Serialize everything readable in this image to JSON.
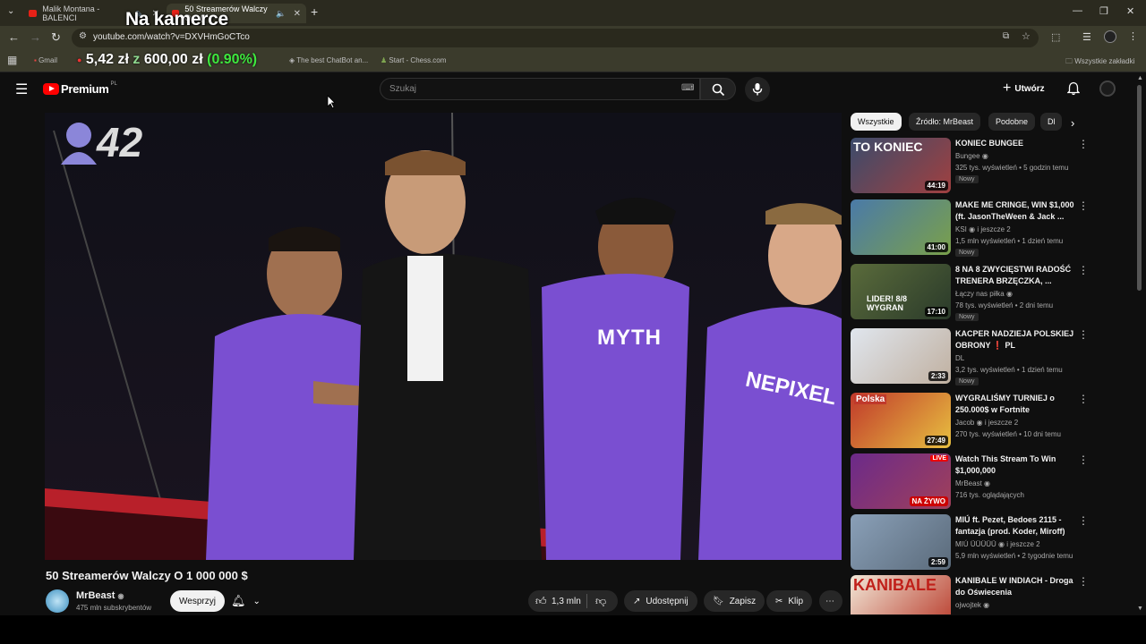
{
  "browser": {
    "tabs": [
      {
        "label": "Malik Montana - BALENCI",
        "active": false
      },
      {
        "label": "50 Streamerów Walczy O 1 (",
        "active": true
      }
    ],
    "new_tab": "+",
    "url": "youtube.com/watch?v=DXVHmGoCTco",
    "bookmarks": [
      {
        "label": "Gmail"
      },
      {
        "label": "The best ChatBot an..."
      },
      {
        "label": "Start - Chess.com"
      }
    ],
    "all_bookmarks": "Wszystkie zakładki"
  },
  "stream_overlay": {
    "title": "Na kamerce",
    "stock_prefix": "5,42 zł",
    "stock_z": "z",
    "stock_value": "600,00 zł",
    "stock_pct": "(0.90%)",
    "viewer_count": "42"
  },
  "youtube": {
    "logo": "Premium",
    "logo_sup": "PL",
    "search_placeholder": "Szukaj",
    "create_label": "Utwórz",
    "chips": [
      "Wszystkie",
      "Źródło: MrBeast",
      "Podobne",
      "Dl"
    ],
    "video": {
      "title": "50 Streamerów Walczy O 1 000 000 $",
      "shirt_text_1": "MYTH",
      "shirt_text_2": "NEPIXEL",
      "channel": "MrBeast",
      "subscribers": "475 mln subskrybentów",
      "support_label": "Wesprzyj",
      "likes": "1,3 mln",
      "share_label": "Udostępnij",
      "save_label": "Zapisz",
      "clip_label": "Klip"
    },
    "recommendations": [
      {
        "title": "KONIEC BUNGEE",
        "channel": "Bungee",
        "meta": "325 tys. wyświetleń • 5 godzin temu",
        "badge": "Nowy",
        "duration": "44:19",
        "thumb_text": "TO KONIEC",
        "color": "#3b4b6b"
      },
      {
        "title": "MAKE ME CRINGE, WIN $1,000 (ft. JasonTheWeen & Jack ...",
        "channel": "KSI",
        "channel_extra": "i jeszcze 2",
        "meta": "1,5 mln wyświetleń • 1 dzień temu",
        "badge": "Nowy",
        "duration": "41:00",
        "thumb_text": "",
        "color": "#4a7aa8"
      },
      {
        "title": "8 NA 8 ZWYCIĘSTWI RADOŚĆ TRENERA BRZĘCZKA, ...",
        "channel": "Łączy nas piłka",
        "meta": "78 tys. wyświetleń • 2 dni temu",
        "badge": "Nowy",
        "duration": "17:10",
        "thumb_text": "LIDER! 8/8 WYGRAN",
        "color": "#5a6b3b"
      },
      {
        "title": "KACPER NADZIEJA POLSKIEJ OBRONY ❗ PL",
        "channel": "DL",
        "meta": "3,2 tys. wyświetleń • 1 dzień temu",
        "badge": "Nowy",
        "duration": "2:33",
        "thumb_text": "",
        "color": "#c9d3e0"
      },
      {
        "title": "WYGRALIŚMY TURNIEJ o 250.000$ w Fortnite",
        "channel": "Jacob",
        "channel_extra": "i jeszcze 2",
        "meta": "270 tys. wyświetleń • 10 dni temu",
        "badge": "",
        "duration": "27:49",
        "thumb_text": "Polska",
        "color": "#c0392b"
      },
      {
        "title": "Watch This Stream To Win $1,000,000",
        "channel": "MrBeast",
        "meta": "716 tys. oglądających",
        "badge": "",
        "duration": "NA ŻYWO",
        "thumb_text": "LIVE",
        "color": "#6b2a8a"
      },
      {
        "title": "MIÚ ft. Pezet, Bedoes 2115 - fantazja (prod. Koder, Miroff)",
        "channel": "MIÚ ÜÜÜÜÜ",
        "channel_extra": "i jeszcze 2",
        "meta": "5,9 mln wyświetleń • 2 tygodnie temu",
        "badge": "",
        "duration": "2:59",
        "thumb_text": "",
        "color": "#8aa0b8"
      },
      {
        "title": "KANIBALE W INDIACH - Droga do Oświecenia",
        "channel": "ojwojtek",
        "meta": "",
        "badge": "",
        "duration": "",
        "thumb_text": "KANIBALE",
        "color": "#b83a2a"
      }
    ]
  }
}
